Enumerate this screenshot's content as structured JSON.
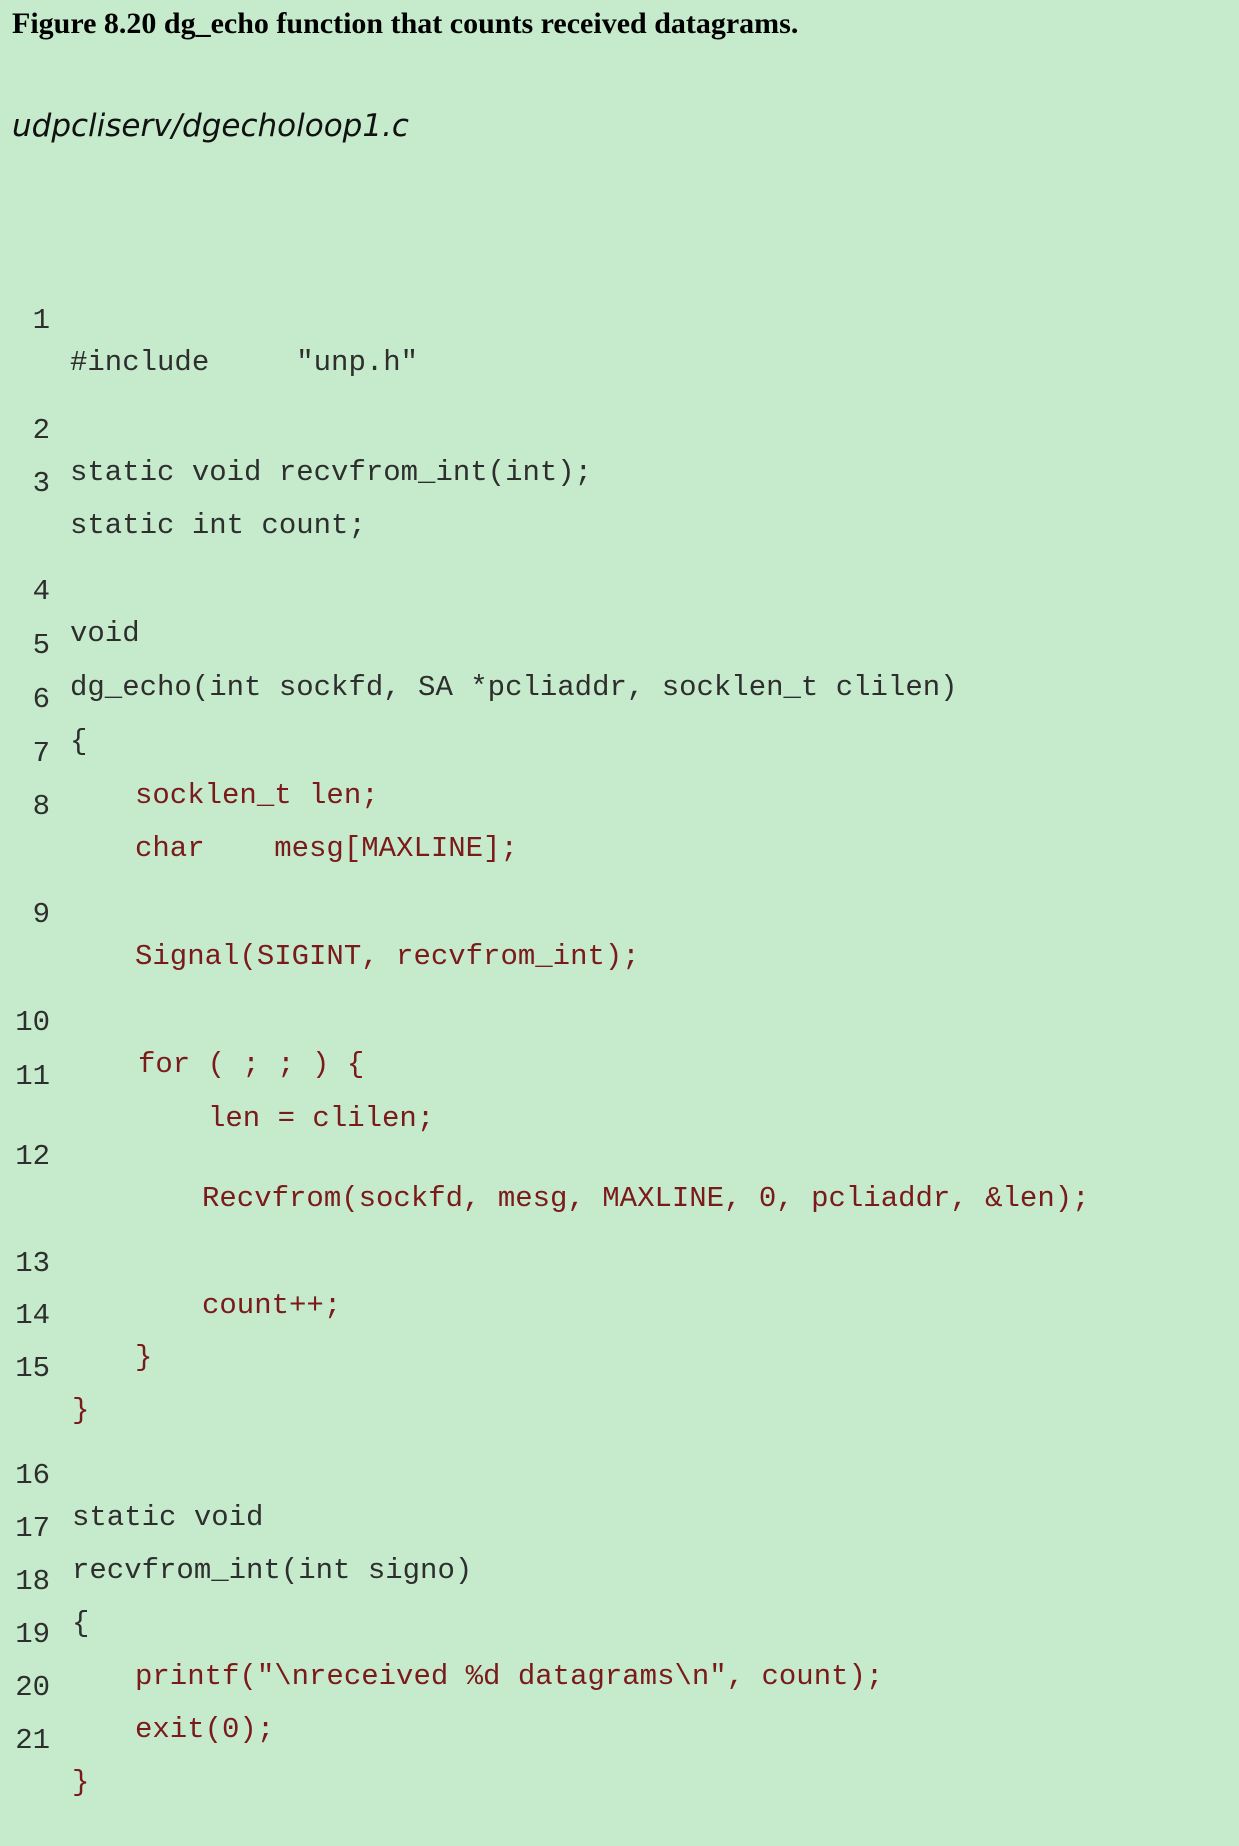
{
  "caption": "Figure 8.20 dg_echo function that counts received datagrams.",
  "filename": "udpcliserv/dgecholoop1.c",
  "colors": {
    "background": "#c6ebcc",
    "code_plain": "#2e2e2e",
    "code_body": "#7a1a1a"
  },
  "lines": [
    {
      "n": "1",
      "text": "#include     \"unp.h\""
    },
    {
      "n": "2",
      "text": "static void recvfrom_int(int);"
    },
    {
      "n": "3",
      "text": "static int count;"
    },
    {
      "n": "4",
      "text": "void"
    },
    {
      "n": "5",
      "text": "dg_echo(int sockfd, SA *pcliaddr, socklen_t clilen)"
    },
    {
      "n": "6",
      "text": "{"
    },
    {
      "n": "7",
      "text": "socklen_t len;"
    },
    {
      "n": "8",
      "text": "char    mesg[MAXLINE];"
    },
    {
      "n": "9",
      "text": "Signal(SIGINT, recvfrom_int);"
    },
    {
      "n": "10",
      "text": "for ( ; ; ) {"
    },
    {
      "n": "11",
      "text": "len = clilen;"
    },
    {
      "n": "12",
      "text": "Recvfrom(sockfd, mesg, MAXLINE, 0, pcliaddr, &len);"
    },
    {
      "n": "13",
      "text": "count++;"
    },
    {
      "n": "14",
      "text": "}"
    },
    {
      "n": "15",
      "text": "}"
    },
    {
      "n": "16",
      "text": "static void"
    },
    {
      "n": "17",
      "text": "recvfrom_int(int signo)"
    },
    {
      "n": "18",
      "text": "{"
    },
    {
      "n": "19",
      "text": "printf(\"\\nreceived %d datagrams\\n\", count);"
    },
    {
      "n": "20",
      "text": "exit(0);"
    },
    {
      "n": "21",
      "text": "}"
    }
  ]
}
